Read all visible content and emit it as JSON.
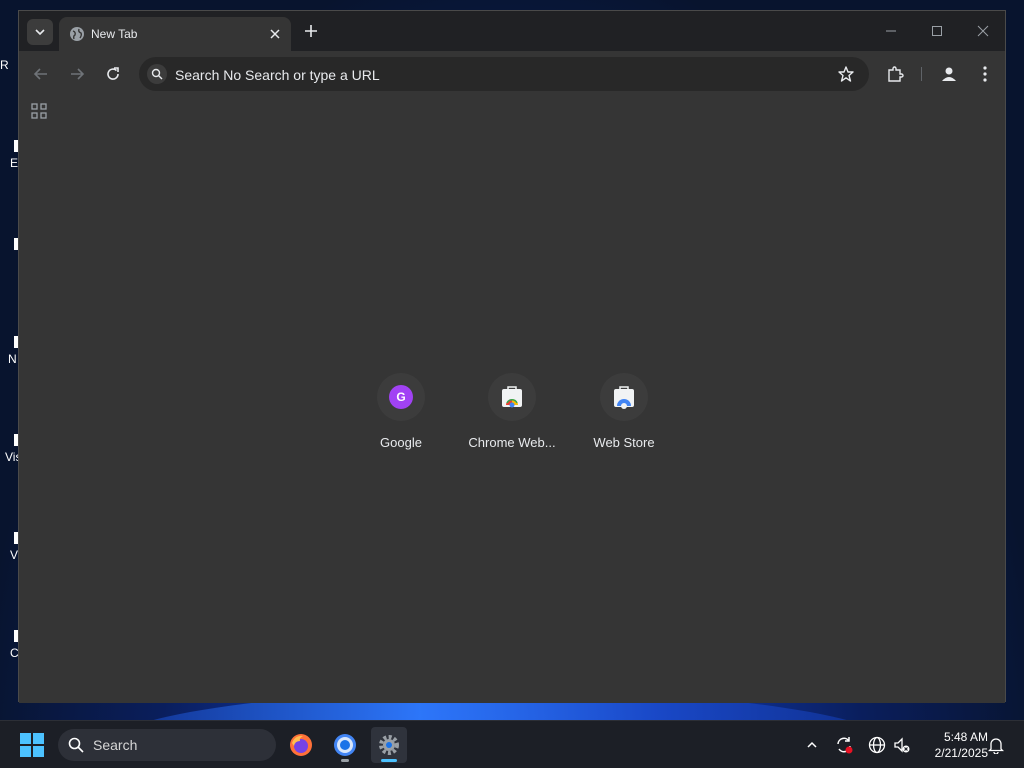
{
  "browser": {
    "tab": {
      "title": "New Tab"
    },
    "omnibox": {
      "placeholder": "Search No Search or type a URL"
    },
    "shortcuts": [
      {
        "label": "Google",
        "letter": "G"
      },
      {
        "label": "Chrome Web..."
      },
      {
        "label": "Web Store"
      }
    ]
  },
  "taskbar": {
    "search_label": "Search",
    "clock": {
      "time": "5:48 AM",
      "date": "2/21/2025"
    }
  },
  "desktop": {
    "icon_labels": [
      "R",
      "E",
      "N",
      "Vis",
      "V",
      "C"
    ]
  },
  "colors": {
    "window_bg": "#353535",
    "titlebar_bg": "#202124",
    "omnibox_bg": "#282828",
    "google_avatar": "#a142f4",
    "taskbar_bg": "#1c1f26",
    "accent": "#4cc2ff"
  }
}
